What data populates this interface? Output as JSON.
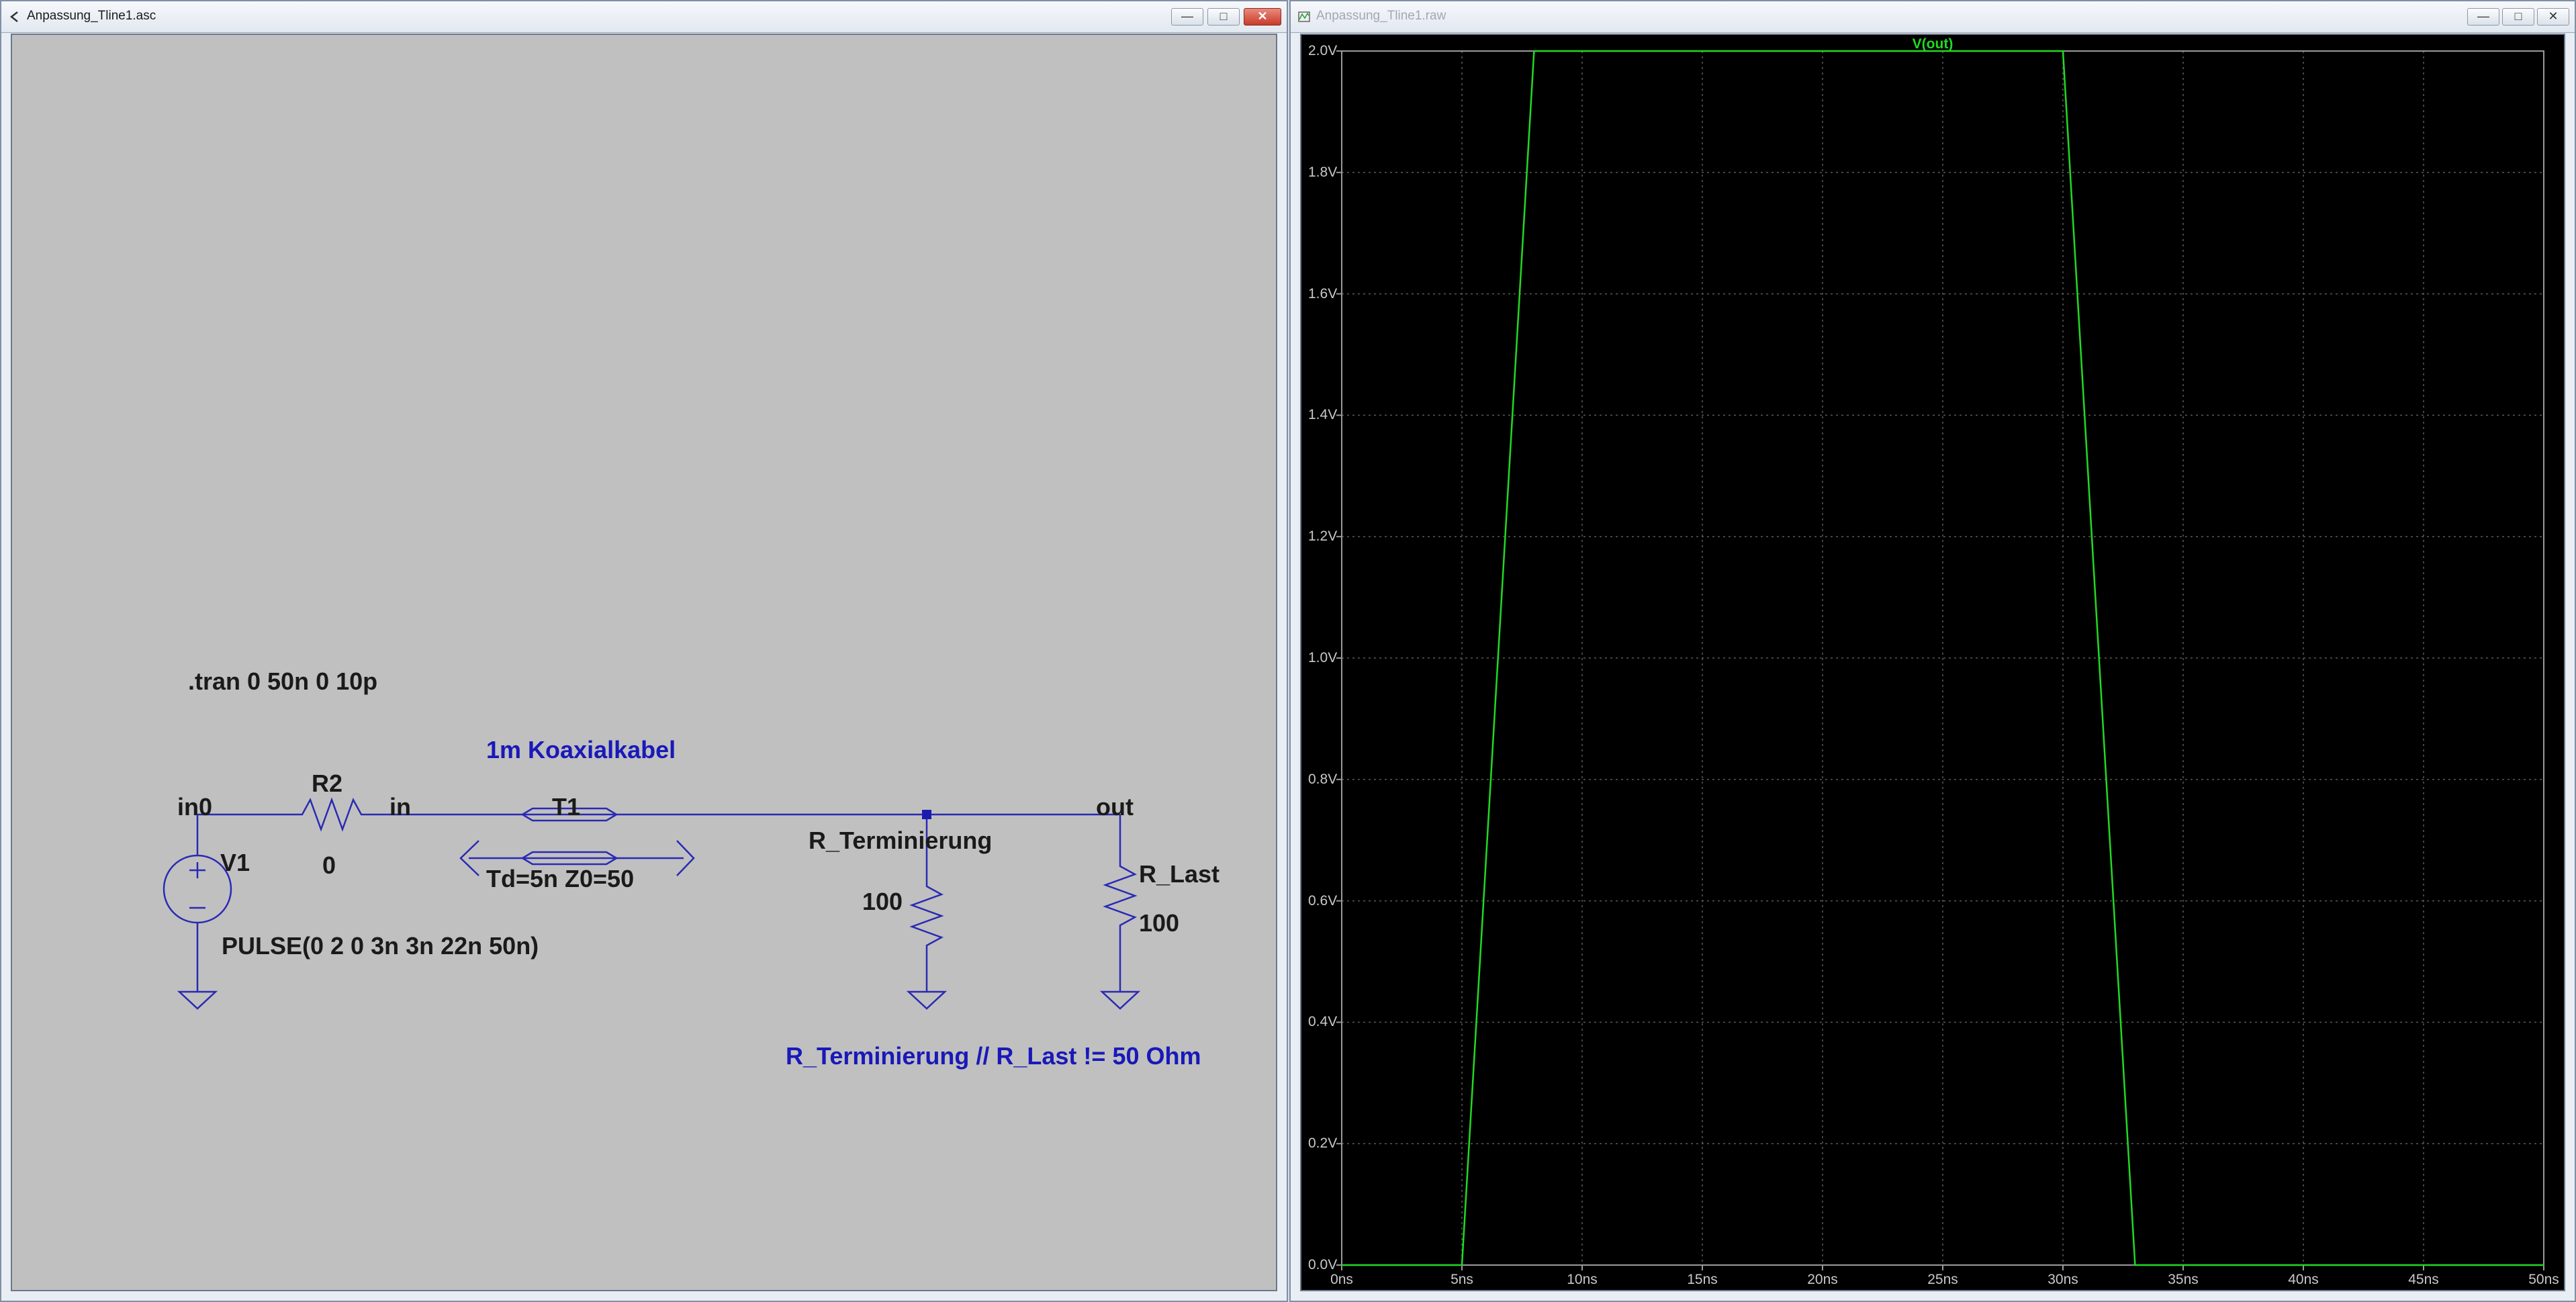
{
  "schematic_window": {
    "title": "Anpassung_Tline1.asc",
    "controls": [
      "—",
      "□",
      "✕"
    ]
  },
  "plot_window": {
    "title": "Anpassung_Tline1.raw",
    "controls": [
      "—",
      "□",
      "✕"
    ]
  },
  "schematic": {
    "directive": ".tran 0 50n 0 10p",
    "cable_comment": "1m Koaxialkabel",
    "note": "R_Terminierung // R_Last != 50 Ohm",
    "labels": {
      "in0": "in0",
      "in": "in",
      "out": "out"
    },
    "components": {
      "r2_name": "R2",
      "r2_value": "0",
      "v1_name": "V1",
      "v1_value": "PULSE(0 2 0 3n 3n 22n 50n)",
      "t1_name": "T1",
      "t1_value": "Td=5n Z0=50",
      "rterm_name": "R_Terminierung",
      "rterm_value": "100",
      "rlast_name": "R_Last",
      "rlast_value": "100"
    },
    "colors": {
      "background": "#c0c0c0",
      "wire": "#2a2ab4",
      "text": "#1a1a1a",
      "comment": "#1919b9"
    }
  },
  "chart_data": {
    "type": "line",
    "title": "V(out)",
    "xlabel": "",
    "ylabel": "",
    "xlim": [
      0,
      50
    ],
    "ylim": [
      0,
      2.0
    ],
    "grid": true,
    "x_ticks": [
      "0ns",
      "5ns",
      "10ns",
      "15ns",
      "20ns",
      "25ns",
      "30ns",
      "35ns",
      "40ns",
      "45ns",
      "50ns"
    ],
    "y_ticks": [
      "0.0V",
      "0.2V",
      "0.4V",
      "0.6V",
      "0.8V",
      "1.0V",
      "1.2V",
      "1.4V",
      "1.6V",
      "1.8V",
      "2.0V"
    ],
    "series": [
      {
        "name": "V(out)",
        "color": "#22d922",
        "x": [
          0,
          5,
          8,
          30,
          33,
          37,
          50
        ],
        "y": [
          0,
          0,
          2.0,
          2.0,
          0,
          0,
          0
        ]
      }
    ],
    "colors": {
      "background": "#000000",
      "axis": "#9a9a9a",
      "grid": "#5a5a5a",
      "tick_text": "#c8c8c8"
    }
  }
}
